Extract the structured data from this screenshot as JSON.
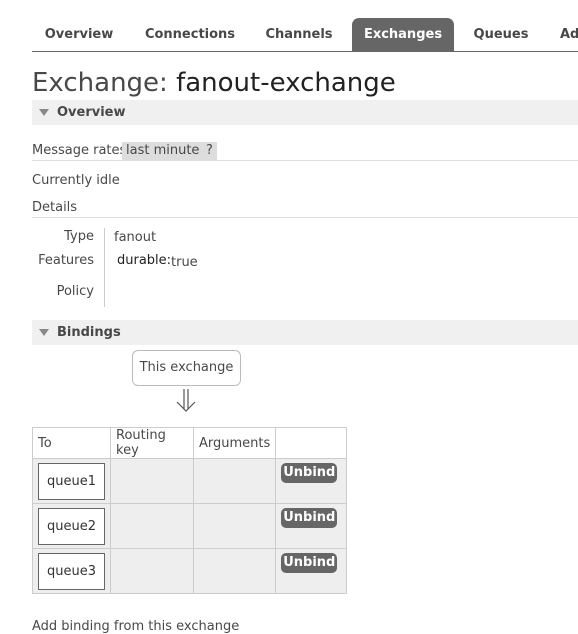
{
  "tabs": [
    "Overview",
    "Connections",
    "Channels",
    "Exchanges",
    "Queues",
    "Ad"
  ],
  "active_tab": "Exchanges",
  "title": {
    "prefix": "Exchange:",
    "name": "fanout-exchange"
  },
  "overview": {
    "heading": "Overview",
    "message_rates_label": "Message rates",
    "rate_range": "last minute",
    "help": "?",
    "idle_text": "Currently idle",
    "details_label": "Details",
    "details": {
      "type_label": "Type",
      "type_value": "fanout",
      "features_label": "Features",
      "durable_key": "durable:",
      "durable_value": "true",
      "policy_label": "Policy"
    }
  },
  "bindings": {
    "heading": "Bindings",
    "source_label": "This exchange",
    "columns": [
      "To",
      "Routing key",
      "Arguments",
      ""
    ],
    "rows": [
      {
        "to": "queue1",
        "routing_key": "",
        "arguments": "",
        "action": "Unbind"
      },
      {
        "to": "queue2",
        "routing_key": "",
        "arguments": "",
        "action": "Unbind"
      },
      {
        "to": "queue3",
        "routing_key": "",
        "arguments": "",
        "action": "Unbind"
      }
    ]
  },
  "add_binding_label": "Add binding from this exchange",
  "colors": {
    "tab_active": "#666666",
    "section_bg": "#f0f0f0",
    "row_bg": "#eeeeee"
  }
}
